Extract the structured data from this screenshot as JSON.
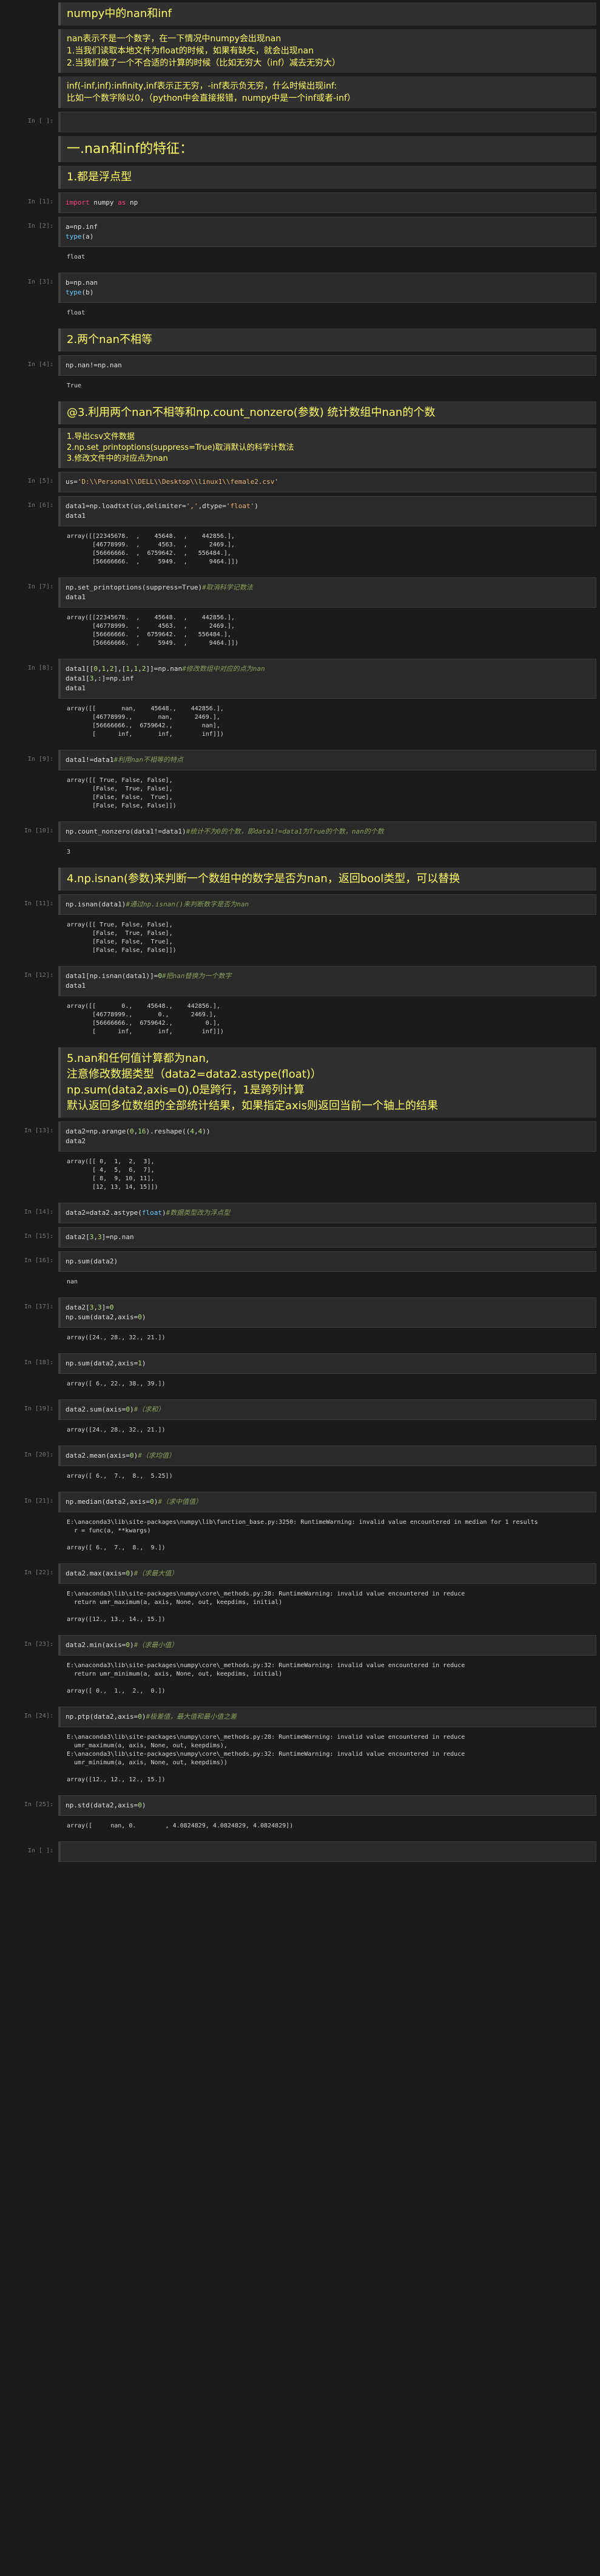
{
  "cells": [
    {
      "kind": "md",
      "style": "title",
      "lines": [
        [
          "",
          "numpy中的nan和inf"
        ]
      ]
    },
    {
      "kind": "md",
      "style": "",
      "lines": [
        [
          "",
          "nan表示不是一个数字，在一下情况中numpy会出现nan"
        ],
        [
          "",
          "1.当我们读取本地文件为float的时候，如果有缺失，就会出现nan"
        ],
        [
          "",
          "2.当我们做了一个不合适的计算的时候（比如无穷大（inf）减去无穷大）"
        ]
      ]
    },
    {
      "kind": "md",
      "style": "",
      "lines": [
        [
          "",
          "inf(-inf,inf):infinity,inf表示正无穷，-inf表示负无穷，什么时候出现inf:"
        ],
        [
          "",
          "比如一个数字除以0，（python中会直接报错，numpy中是一个inf或者-inf）"
        ]
      ]
    },
    {
      "kind": "code",
      "prompt": "In [ ]:",
      "lines": [
        ""
      ]
    },
    {
      "kind": "md",
      "style": "big",
      "lines": [
        [
          "",
          "一.nan和inf的特征："
        ]
      ]
    },
    {
      "kind": "md",
      "style": "title",
      "lines": [
        [
          "",
          "1.都是浮点型"
        ]
      ]
    },
    {
      "kind": "code",
      "prompt": "In [1]:",
      "lines": [
        "import numpy as np"
      ]
    },
    {
      "kind": "code",
      "prompt": "In [2]:",
      "lines": [
        "a=np.inf",
        "type(a)"
      ],
      "output": "float"
    },
    {
      "kind": "code",
      "prompt": "In [3]:",
      "lines": [
        "b=np.nan",
        "type(b)"
      ],
      "output": "float"
    },
    {
      "kind": "md",
      "style": "title",
      "lines": [
        [
          "",
          "2.两个nan不相等"
        ]
      ]
    },
    {
      "kind": "code",
      "prompt": "In [4]:",
      "lines": [
        "np.nan!=np.nan"
      ],
      "output": "True"
    },
    {
      "kind": "md",
      "style": "title",
      "lines": [
        [
          "",
          "@3.利用两个nan不相等和np.count_nonzero(参数) 统计数组中nan的个数"
        ]
      ]
    },
    {
      "kind": "md",
      "style": "sub",
      "lines": [
        [
          "",
          "1.导出csv文件数据"
        ],
        [
          "",
          "2.np.set_printoptions(suppress=True)取消默认的科学计数法"
        ],
        [
          "",
          "3.修改文件中的对应点为nan"
        ]
      ]
    },
    {
      "kind": "code",
      "prompt": "In [5]:",
      "lines": [
        "us='D:\\\\Personal\\\\DELL\\\\Desktop\\\\linux1\\\\female2.csv'"
      ]
    },
    {
      "kind": "code",
      "prompt": "In [6]:",
      "lines": [
        "data1=np.loadtxt(us,delimiter=',',dtype='float')",
        "data1"
      ],
      "output": "array([[22345678.  ,    45648.  ,    442856.],\n       [46778999.  ,     4563.  ,      2469.],\n       [56666666.  ,  6759642.  ,   556484.],\n       [56666666.  ,     5949.  ,      9464.]])"
    },
    {
      "kind": "code",
      "prompt": "In [7]:",
      "lines": [
        "np.set_printoptions(suppress=True)#取消科学记数法",
        "data1"
      ],
      "output": "array([[22345678.  ,    45648.  ,    442856.],\n       [46778999.  ,     4563.  ,      2469.],\n       [56666666.  ,  6759642.  ,   556484.],\n       [56666666.  ,     5949.  ,      9464.]])"
    },
    {
      "kind": "code",
      "prompt": "In [8]:",
      "lines": [
        "data1[[0,1,2],[1,1,2]]=np.nan#修改数组中对应的点为nan",
        "data1[3,:]=np.inf",
        "data1"
      ],
      "output": "array([[       nan,    45648.,    442856.],\n       [46778999.,       nan,      2469.],\n       [56666666.,  6759642.,        nan],\n       [      inf,       inf,        inf]])"
    },
    {
      "kind": "code",
      "prompt": "In [9]:",
      "lines": [
        "data1!=data1#利用nan不相等的特点"
      ],
      "output": "array([[ True, False, False],\n       [False,  True, False],\n       [False, False,  True],\n       [False, False, False]])"
    },
    {
      "kind": "code",
      "prompt": "In [10]:",
      "lines": [
        "np.count_nonzero(data1!=data1)#统计不为0的个数，即data1!=data1为True的个数，nan的个数"
      ],
      "output": "3"
    },
    {
      "kind": "md",
      "style": "title",
      "lines": [
        [
          "",
          "4.np.isnan(参数)来判断一个数组中的数字是否为nan，返回bool类型，可以替换"
        ]
      ]
    },
    {
      "kind": "code",
      "prompt": "In [11]:",
      "lines": [
        "np.isnan(data1)#通过np.isnan()来判断数字是否为nan"
      ],
      "output": "array([[ True, False, False],\n       [False,  True, False],\n       [False, False,  True],\n       [False, False, False]])"
    },
    {
      "kind": "code",
      "prompt": "In [12]:",
      "lines": [
        "data1[np.isnan(data1)]=0#把nan替换为一个数字",
        "data1"
      ],
      "output": "array([[       0.,    45648.,    442856.],\n       [46778999.,       0.,      2469.],\n       [56666666.,  6759642.,         0.],\n       [      inf,       inf,        inf]])"
    },
    {
      "kind": "md",
      "style": "title",
      "lines": [
        [
          "",
          "5.nan和任何值计算都为nan,"
        ],
        [
          "",
          "注意修改数据类型（data2=data2.astype(float)）"
        ],
        [
          "",
          "np.sum(data2,axis=0),0是跨行，1是跨列计算"
        ],
        [
          "",
          "默认返回多位数组的全部统计结果，如果指定axis则返回当前一个轴上的结果"
        ]
      ]
    },
    {
      "kind": "code",
      "prompt": "In [13]:",
      "lines": [
        "data2=np.arange(0,16).reshape((4,4))",
        "data2"
      ],
      "output": "array([[ 0,  1,  2,  3],\n       [ 4,  5,  6,  7],\n       [ 8,  9, 10, 11],\n       [12, 13, 14, 15]])"
    },
    {
      "kind": "code",
      "prompt": "In [14]:",
      "lines": [
        "data2=data2.astype(float)#数据类型改为浮点型"
      ]
    },
    {
      "kind": "code",
      "prompt": "In [15]:",
      "lines": [
        "data2[3,3]=np.nan"
      ]
    },
    {
      "kind": "code",
      "prompt": "In [16]:",
      "lines": [
        "np.sum(data2)"
      ],
      "output": "nan"
    },
    {
      "kind": "code",
      "prompt": "In [17]:",
      "lines": [
        "data2[3,3]=0",
        "np.sum(data2,axis=0)"
      ],
      "output": "array([24., 28., 32., 21.])"
    },
    {
      "kind": "code",
      "prompt": "In [18]:",
      "lines": [
        "np.sum(data2,axis=1)"
      ],
      "output": "array([ 6., 22., 38., 39.])"
    },
    {
      "kind": "code",
      "prompt": "In [19]:",
      "lines": [
        "data2.sum(axis=0)#（求和）"
      ],
      "output": "array([24., 28., 32., 21.])"
    },
    {
      "kind": "code",
      "prompt": "In [20]:",
      "lines": [
        "data2.mean(axis=0)#（求均值）"
      ],
      "output": "array([ 6.,  7.,  8.,  5.25])"
    },
    {
      "kind": "code",
      "prompt": "In [21]:",
      "lines": [
        "np.median(data2,axis=0)#（求中值值）"
      ],
      "output": "E:\\anaconda3\\lib\\site-packages\\numpy\\lib\\function_base.py:3250: RuntimeWarning: invalid value encountered in median for 1 results\n  r = func(a, **kwargs)\n\narray([ 6.,  7.,  8.,  9.])"
    },
    {
      "kind": "code",
      "prompt": "In [22]:",
      "lines": [
        "data2.max(axis=0)#（求最大值）"
      ],
      "output": "E:\\anaconda3\\lib\\site-packages\\numpy\\core\\_methods.py:28: RuntimeWarning: invalid value encountered in reduce\n  return umr_maximum(a, axis, None, out, keepdims, initial)\n\narray([12., 13., 14., 15.])"
    },
    {
      "kind": "code",
      "prompt": "In [23]:",
      "lines": [
        "data2.min(axis=0)#（求最小值）"
      ],
      "output": "E:\\anaconda3\\lib\\site-packages\\numpy\\core\\_methods.py:32: RuntimeWarning: invalid value encountered in reduce\n  return umr_minimum(a, axis, None, out, keepdims, initial)\n\narray([ 0.,  1.,  2.,  0.])"
    },
    {
      "kind": "code",
      "prompt": "In [24]:",
      "lines": [
        "np.ptp(data2,axis=0)#极差值，最大值和最小值之差"
      ],
      "output": "E:\\anaconda3\\lib\\site-packages\\numpy\\core\\_methods.py:28: RuntimeWarning: invalid value encountered in reduce\n  umr_maximum(a, axis, None, out, keepdims),\nE:\\anaconda3\\lib\\site-packages\\numpy\\core\\_methods.py:32: RuntimeWarning: invalid value encountered in reduce\n  umr_minimum(a, axis, None, out, keepdims))\n\narray([12., 12., 12., 15.])"
    },
    {
      "kind": "code",
      "prompt": "In [25]:",
      "lines": [
        "np.std(data2,axis=0)"
      ],
      "output": "array([     nan, 0.        , 4.0824829, 4.0824829, 4.0824829])"
    },
    {
      "kind": "code",
      "prompt": "In [ ]:",
      "lines": [
        ""
      ]
    }
  ]
}
